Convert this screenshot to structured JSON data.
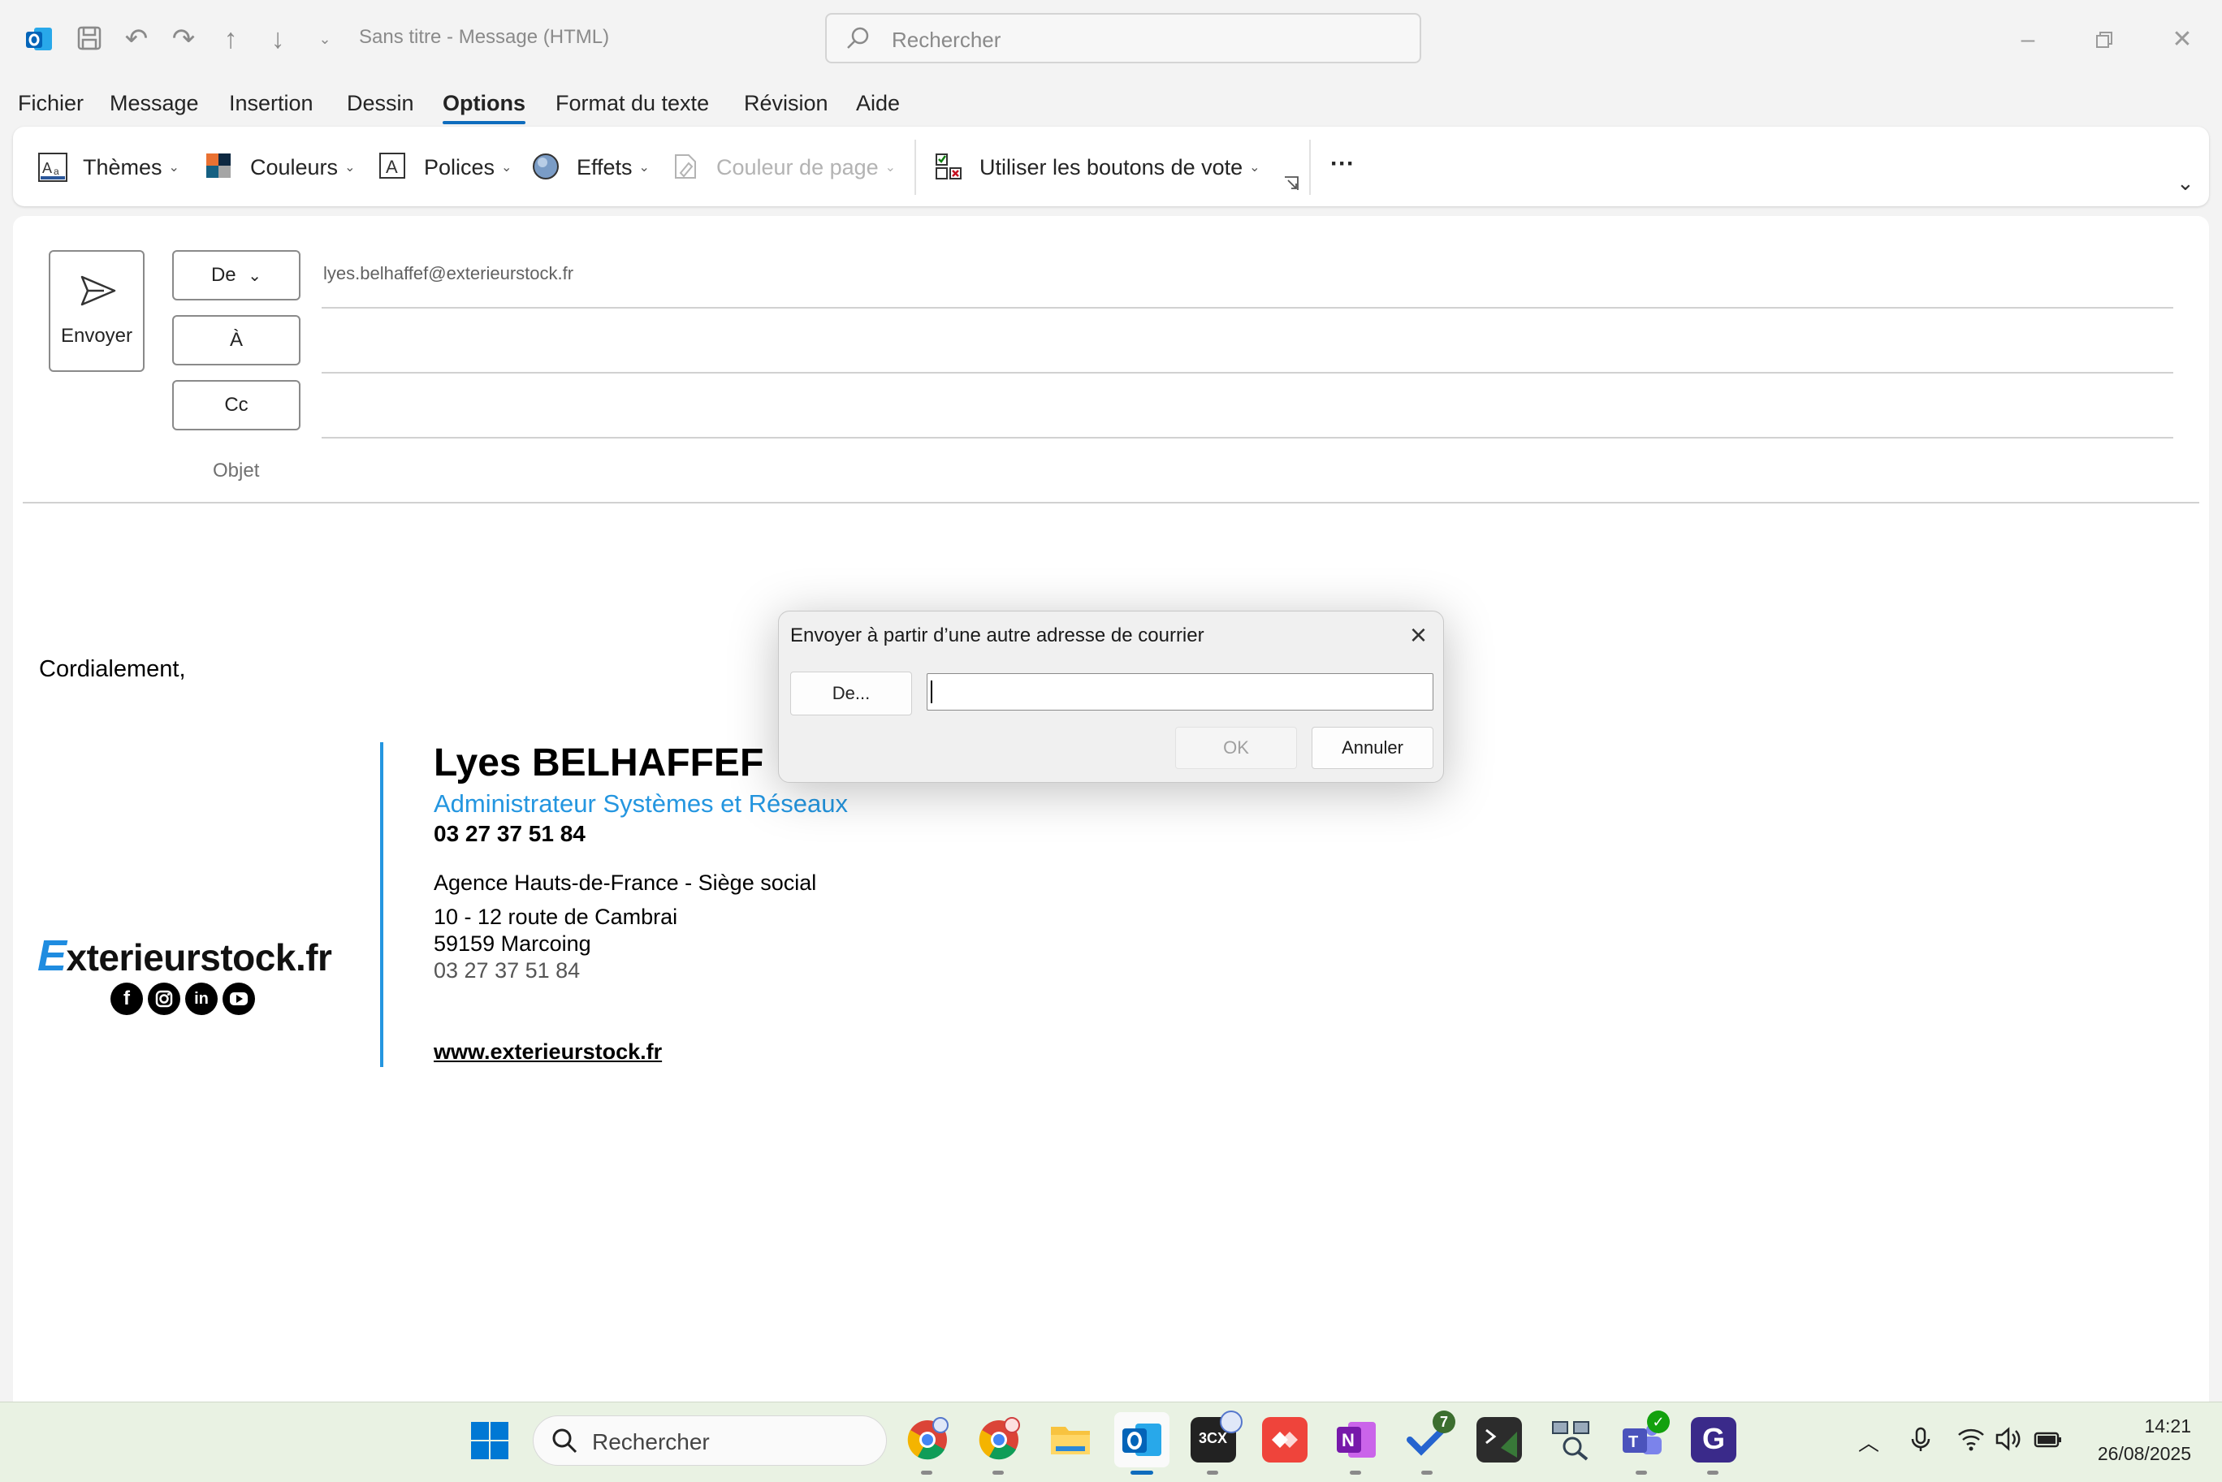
{
  "window": {
    "title": "Sans titre  -  Message (HTML)",
    "search_placeholder": "Rechercher"
  },
  "menu": [
    "Fichier",
    "Message",
    "Insertion",
    "Dessin",
    "Options",
    "Format du texte",
    "Révision",
    "Aide"
  ],
  "menu_active": "Options",
  "ribbon": {
    "themes": "Thèmes",
    "colors": "Couleurs",
    "fonts": "Polices",
    "effects": "Effets",
    "page_color": "Couleur de page",
    "voting": "Utiliser les boutons de vote",
    "more": "···"
  },
  "compose": {
    "send": "Envoyer",
    "from_btn": "De",
    "to_btn": "À",
    "cc_btn": "Cc",
    "subject_label": "Objet",
    "from_address": "lyes.belhaffef@exterieurstock.fr"
  },
  "body": {
    "greeting": "Cordialement,",
    "signature": {
      "logo_first": "E",
      "logo_rest": "xterieurstock.fr",
      "name": "Lyes BELHAFFEF",
      "role": "Administrateur Systèmes et Réseaux",
      "phone": "03 27 37 51 84",
      "agency": "Agence Hauts-de-France - Siège social",
      "address1": "10 - 12 route de Cambrai",
      "address2": "59159 Marcoing",
      "tel": "03 27 37 51 84",
      "website": "www.exterieurstock.fr",
      "social_icons": [
        "facebook-icon",
        "instagram-icon",
        "linkedin-icon",
        "youtube-icon"
      ]
    }
  },
  "dialog": {
    "title": "Envoyer à partir d’une autre adresse de courrier",
    "from_btn": "De...",
    "input_value": "",
    "ok": "OK",
    "cancel": "Annuler"
  },
  "taskbar": {
    "search_placeholder": "Rechercher",
    "todo_badge": "7",
    "time": "14:21",
    "date": "26/08/2025"
  },
  "colors": {
    "accent": "#0f6cbd",
    "signature_blue": "#2496e0",
    "taskbar_bg": "#e9f2e3"
  }
}
